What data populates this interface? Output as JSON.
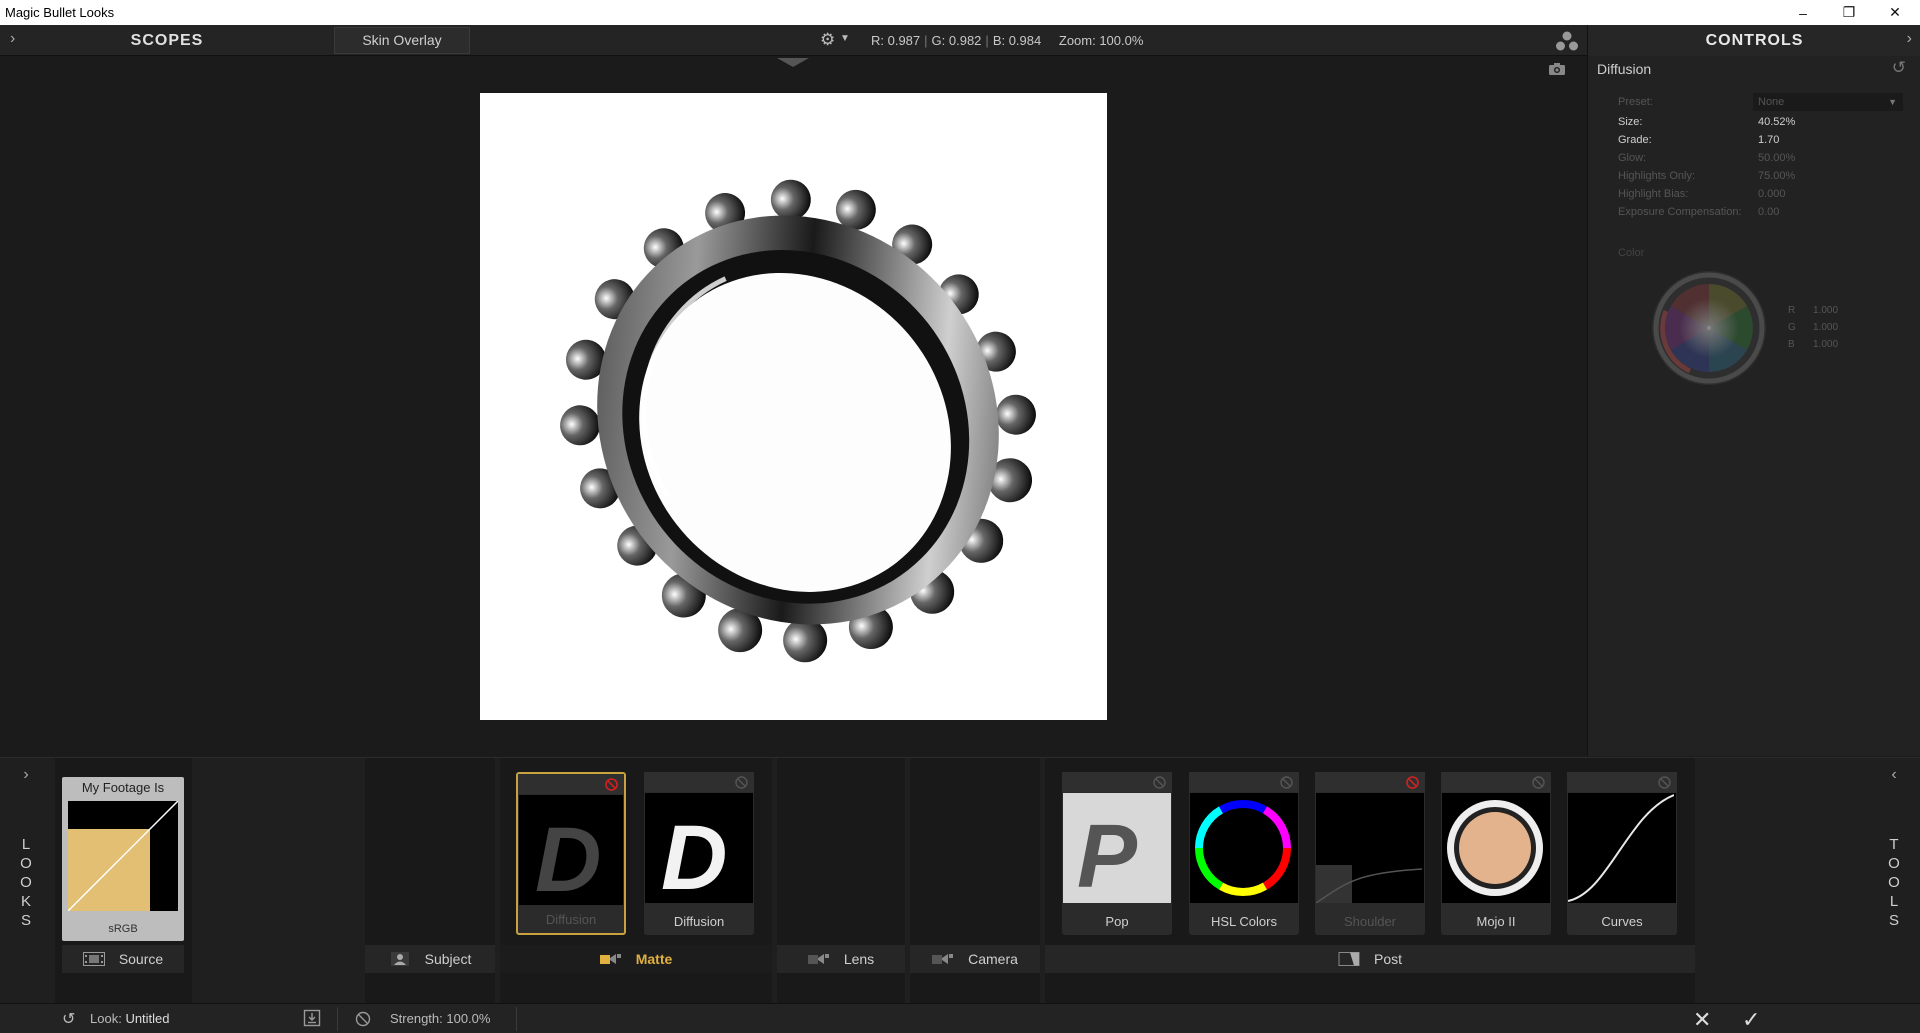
{
  "window": {
    "title": "Magic Bullet Looks",
    "minimize": "–",
    "restore": "❐",
    "close": "✕"
  },
  "topbar": {
    "scopes_label": "SCOPES",
    "skin_overlay_label": "Skin Overlay",
    "r": "R: 0.987",
    "g": "G: 0.982",
    "b": "B: 0.984",
    "zoom": "Zoom: 100.0%",
    "controls_label": "CONTROLS"
  },
  "controls": {
    "tool_title": "Diffusion",
    "params": [
      {
        "label": "Preset:",
        "value": "None",
        "enabled": false
      },
      {
        "label": "Size:",
        "value": "40.52%",
        "enabled": true
      },
      {
        "label": "Grade:",
        "value": "1.70",
        "enabled": true
      },
      {
        "label": "Glow:",
        "value": "50.00%",
        "enabled": false
      },
      {
        "label": "Highlights Only:",
        "value": "75.00%",
        "enabled": false
      },
      {
        "label": "Highlight Bias:",
        "value": "0.000",
        "enabled": false
      },
      {
        "label": "Exposure Compensation:",
        "value": "0.00",
        "enabled": false
      }
    ],
    "color_label": "Color",
    "color_r": {
      "label": "R",
      "value": "1.000"
    },
    "color_g": {
      "label": "G",
      "value": "1.000"
    },
    "color_b": {
      "label": "B",
      "value": "1.000"
    }
  },
  "looks_side": {
    "letters": "L\nO\nO\nK\nS"
  },
  "tools_side": {
    "letters": "T\nO\nO\nL\nS"
  },
  "footage": {
    "header": "My Footage Is",
    "footer": "sRGB",
    "swatch_color": "#e2bf72",
    "source_label": "Source"
  },
  "tools": [
    {
      "name": "Diffusion",
      "enabled": false,
      "selected": true
    },
    {
      "name": "Diffusion",
      "enabled": true,
      "selected": false
    },
    {
      "name": "Pop",
      "enabled": true,
      "selected": false
    },
    {
      "name": "HSL Colors",
      "enabled": true,
      "selected": false
    },
    {
      "name": "Shoulder",
      "enabled": false,
      "selected": false
    },
    {
      "name": "Mojo II",
      "enabled": true,
      "selected": false
    },
    {
      "name": "Curves",
      "enabled": true,
      "selected": false
    }
  ],
  "categories": {
    "subject": "Subject",
    "matte": "Matte",
    "lens": "Lens",
    "camera": "Camera",
    "post": "Post"
  },
  "status": {
    "look_prefix": "Look:",
    "look_name": "Untitled",
    "strength": "Strength: 100.0%"
  },
  "colors": {
    "accent": "#c9a13e",
    "disabled_icon": "#d32020"
  }
}
